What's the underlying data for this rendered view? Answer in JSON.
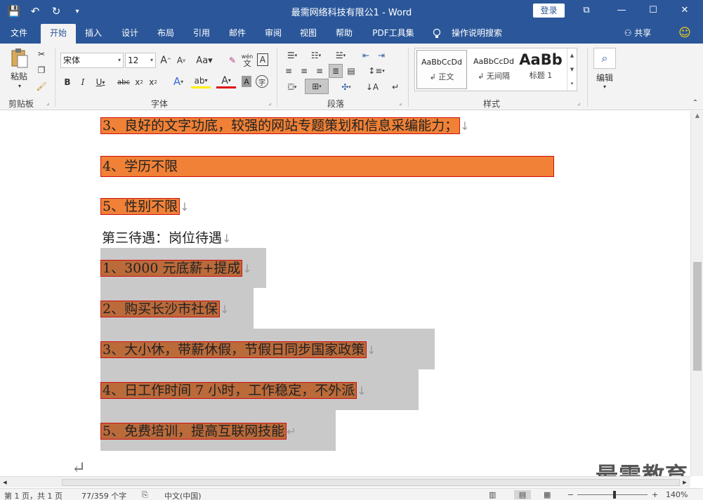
{
  "window": {
    "title": "最需网络科技有限公1  -  Word",
    "login_label": "登录",
    "controls": [
      "⧉",
      "—",
      "☐",
      "✕"
    ]
  },
  "qat": {
    "save": "💾",
    "undo": "↶",
    "redo": "↻",
    "customize": "▾"
  },
  "tabs": [
    "文件",
    "开始",
    "插入",
    "设计",
    "布局",
    "引用",
    "邮件",
    "审阅",
    "视图",
    "帮助",
    "PDF工具集",
    "操作说明搜索"
  ],
  "tab_right": {
    "share": "共享",
    "feedback": "☺"
  },
  "ribbon": {
    "clipboard": {
      "paste": "粘贴",
      "label": "剪贴板"
    },
    "font": {
      "name": "宋体",
      "size": "12",
      "label": "字体",
      "wen": "wén",
      "wen_sub": "文"
    },
    "paragraph": {
      "label": "段落"
    },
    "styles": {
      "label": "样式",
      "items": [
        {
          "preview": "AaBbCcDd",
          "name": "↲ 正文"
        },
        {
          "preview": "AaBbCcDd",
          "name": "↲ 无间隔"
        },
        {
          "preview": "AaBb",
          "name": "标题 1"
        }
      ]
    },
    "editing": {
      "label": "编辑"
    }
  },
  "document": {
    "lines": [
      {
        "text": "3、良好的文字功底，较强的网站专题策划和信息采编能力；",
        "mark": "↓"
      },
      {
        "text": "4、学历不限",
        "mark": ""
      },
      {
        "text": "5、性别不限",
        "mark": "↓"
      },
      {
        "text": "第三待遇：岗位待遇",
        "mark": "↓"
      },
      {
        "text": "1、3000 元底薪+提成",
        "mark": "↓"
      },
      {
        "text": "2、购买长沙市社保",
        "mark": "↓"
      },
      {
        "text": "3、大小休，带薪休假，节假日同步国家政策",
        "mark": "↓"
      },
      {
        "text": "4、日工作时间 7 小时，工作稳定，不外派",
        "mark": "↓"
      },
      {
        "text": "5、免费培训，提高互联网技能",
        "mark": "↵"
      }
    ],
    "trailing_mark": "↵"
  },
  "watermark": "最需教育",
  "statusbar": {
    "page": "第 1 页，共 1 页",
    "words": "77/359 个字",
    "lang": "中文(中国)",
    "zoom": "140%"
  }
}
